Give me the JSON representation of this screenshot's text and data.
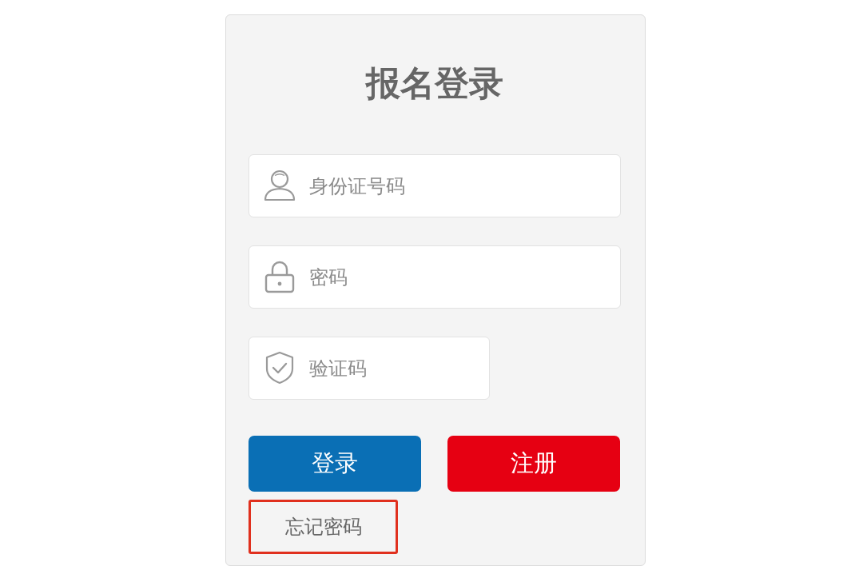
{
  "login_card": {
    "title": "报名登录",
    "fields": [
      {
        "kind": "user",
        "placeholder": "身份证号码"
      },
      {
        "kind": "password",
        "placeholder": "密码"
      },
      {
        "kind": "captcha",
        "placeholder": "验证码"
      }
    ],
    "buttons": [
      {
        "kind": "primary",
        "label": "登录"
      },
      {
        "kind": "danger",
        "label": "注册"
      }
    ],
    "forgot_link": {
      "label": "忘记密码",
      "highlighted": true
    }
  }
}
